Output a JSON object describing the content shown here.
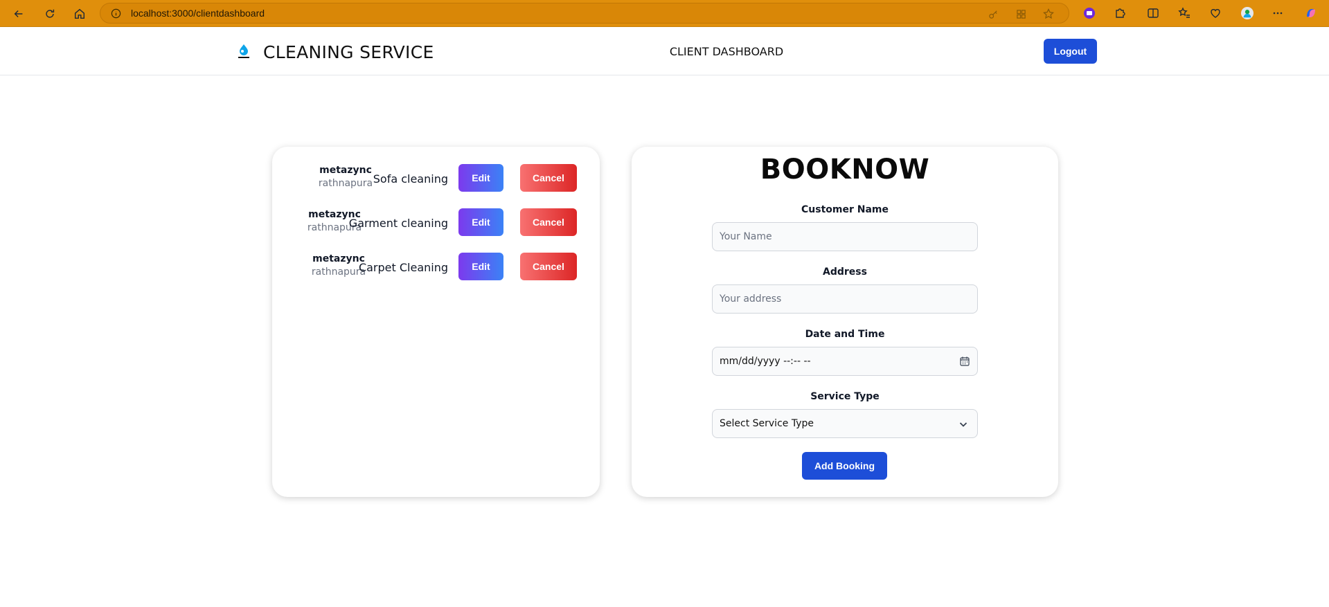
{
  "browser": {
    "url": "localhost:3000/clientdashboard",
    "accent_color": "#e08f0c"
  },
  "header": {
    "brand": "CLEANING SERVICE",
    "title": "CLIENT DASHBOARD",
    "logout_label": "Logout",
    "logo_icon": "water-drop-logo"
  },
  "bookings": [
    {
      "client": "metazync",
      "city": "rathnapura",
      "service": "Sofa cleaning",
      "edit_label": "Edit",
      "cancel_label": "Cancel"
    },
    {
      "client": "metazync",
      "city": "rathnapura",
      "service": "Garment cleaning",
      "edit_label": "Edit",
      "cancel_label": "Cancel"
    },
    {
      "client": "metazync",
      "city": "rathnapura",
      "service": "Carpet Cleaning",
      "edit_label": "Edit",
      "cancel_label": "Cancel"
    }
  ],
  "form": {
    "title": "BOOKNOW",
    "customer_name_label": "Customer Name",
    "customer_name_placeholder": "Your Name",
    "address_label": "Address",
    "address_placeholder": "Your address",
    "datetime_label": "Date and Time",
    "datetime_placeholder": "mm/dd/yyyy --:-- --",
    "service_type_label": "Service Type",
    "service_type_selected": "Select Service Type",
    "submit_label": "Add Booking"
  },
  "colors": {
    "primary": "#1d4ed8",
    "edit_gradient": [
      "#7c3aed",
      "#3b82f6"
    ],
    "cancel_gradient": [
      "#f87171",
      "#dc2626"
    ]
  }
}
